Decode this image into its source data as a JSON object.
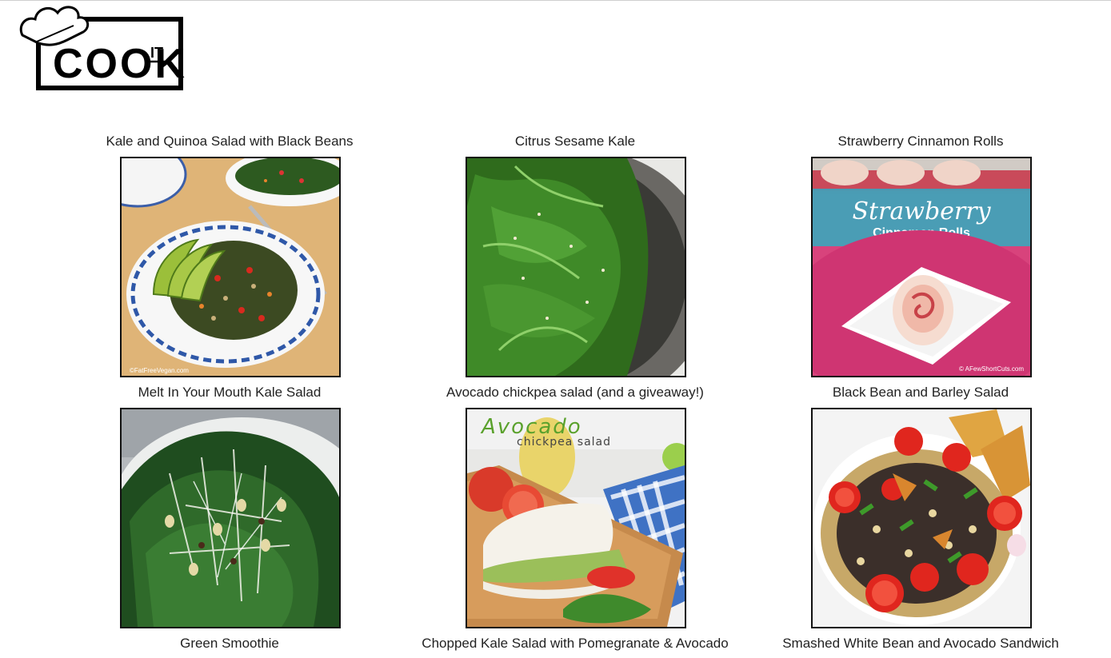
{
  "logo": {
    "text": "COOK",
    "superscript": "IT"
  },
  "recipes": [
    {
      "title": "Kale and Quinoa Salad with Black Beans",
      "image_watermark": "©FatFreeVegan.com"
    },
    {
      "title": "Citrus Sesame Kale"
    },
    {
      "title": "Strawberry Cinnamon Rolls",
      "image_caption_1": "Strawberry",
      "image_caption_2": "Cinnamon Rolls",
      "image_watermark": "© AFewShortCuts.com"
    },
    {
      "title": "Melt In Your Mouth Kale Salad"
    },
    {
      "title": "Avocado chickpea salad (and a giveaway!)",
      "image_caption_1": "Avocado",
      "image_caption_2": "chickpea salad"
    },
    {
      "title": "Black Bean and Barley Salad"
    }
  ],
  "bottom_titles": [
    "Green Smoothie",
    "Chopped Kale Salad with Pomegranate & Avocado",
    "Smashed White Bean and Avocado Sandwich"
  ]
}
